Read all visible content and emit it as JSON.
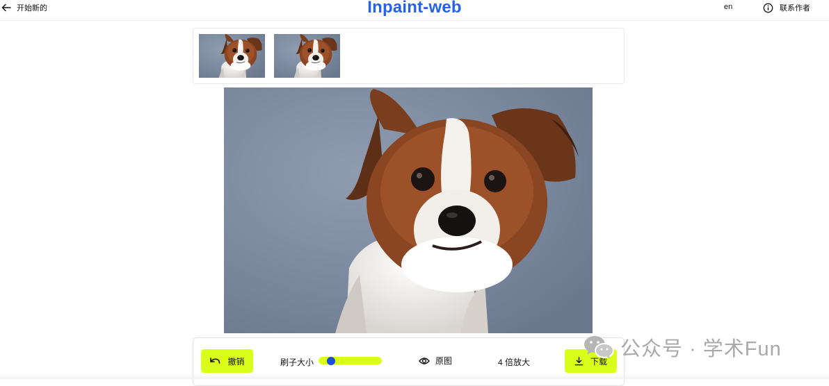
{
  "header": {
    "back_label": "开始新的",
    "title": "Inpaint-web",
    "language": "en",
    "contact_label": "联系作者"
  },
  "thumbnails": [
    {
      "icon": "dog-image"
    },
    {
      "icon": "dog-image"
    }
  ],
  "toolbar": {
    "undo_label": "撤销",
    "brush_label": "刷子大小",
    "brush_size_fraction": 0.2,
    "original_label": "原图",
    "zoom_label": "4 倍放大",
    "download_label": "下载"
  },
  "watermark": {
    "text": "公众号 · 学术Fun"
  },
  "colors": {
    "accent": "#d9ff1a",
    "title": "#2563eb",
    "slider_thumb": "#1d4ed8"
  }
}
